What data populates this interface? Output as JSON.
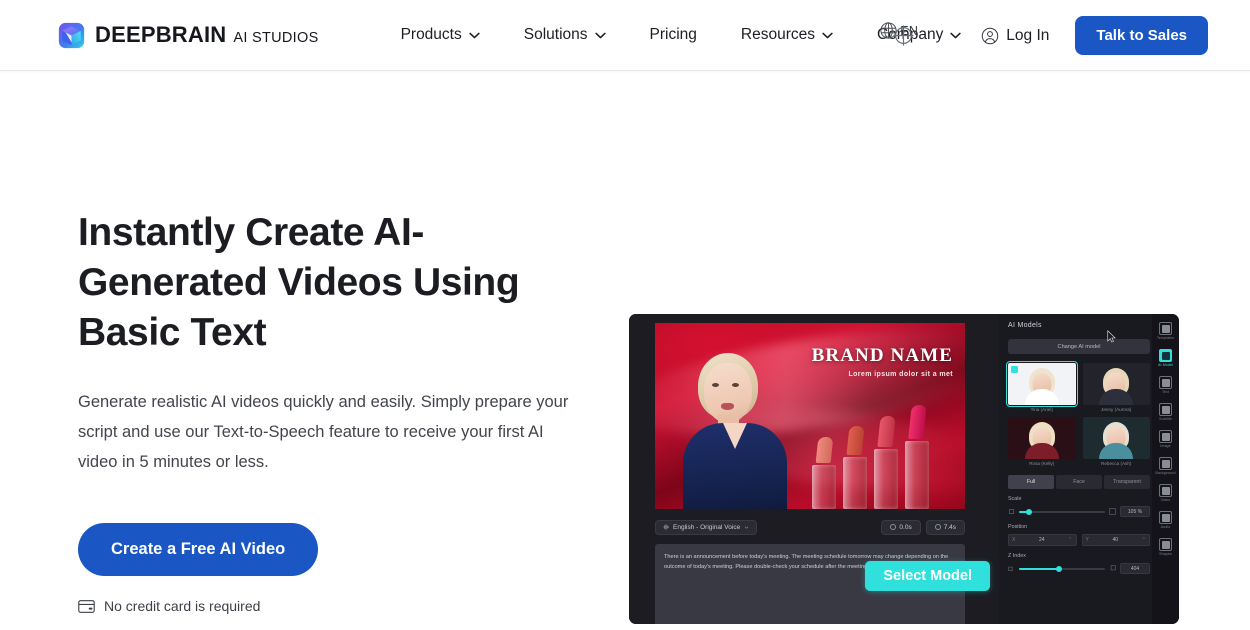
{
  "brand": {
    "logo_icon": "deepbrain-cube-logo",
    "name": "DEEPBRAIN",
    "sub": "AI STUDIOS"
  },
  "header": {
    "nav": [
      {
        "label": "Products",
        "has_chevron": true,
        "icon": "chevron-down-icon"
      },
      {
        "label": "Solutions",
        "has_chevron": true,
        "icon": "chevron-down-icon"
      },
      {
        "label": "Pricing",
        "has_chevron": false,
        "icon": ""
      },
      {
        "label": "Resources",
        "has_chevron": true,
        "icon": "chevron-down-icon"
      },
      {
        "label": "Company",
        "has_chevron": true,
        "icon": "chevron-down-icon"
      }
    ],
    "language": {
      "icon": "globe-icon",
      "code": "EN"
    },
    "login": {
      "label": "Log In",
      "icon": "user-circle-icon"
    },
    "cta": {
      "label": "Talk to Sales"
    }
  },
  "hero": {
    "title": "Instantly Create AI-Generated Videos Using Basic Text",
    "subtitle": "Generate realistic AI videos quickly and easily. Simply prepare your script and use our Text-to-Speech feature to receive your first AI video in 5 minutes or less.",
    "cta_label": "Create a Free AI Video",
    "note": "No credit card is required",
    "note_icon": "credit-card-icon"
  },
  "demo": {
    "stage": {
      "brand_title": "BRAND NAME",
      "brand_sub": "Lorem ipsum dolor sit a met"
    },
    "voice_chip": {
      "icon": "voice-wave-icon",
      "label": "English - Original Voice"
    },
    "timing": [
      {
        "icon": "clock-icon",
        "label": "0.0s"
      },
      {
        "icon": "clock-icon",
        "label": "7.4s"
      }
    ],
    "script": "There is an announcement before today's meeting. The meeting schedule tomorrow may change depending on the outcome of today's meeting. Please double-check your schedule after the meeting.",
    "select_model_label": "Select Model",
    "side": {
      "title": "AI Models",
      "change_model_label": "Change AI model",
      "models": [
        {
          "label": "Tina (Ariel)",
          "active": true,
          "hair": "#f0e3cd",
          "body": "#f2f3f6"
        },
        {
          "label": "Jenny (Aurora)",
          "active": false,
          "hair": "#e9d8b8",
          "body": "#2d2f3d"
        },
        {
          "label": "Rosa (Kelly)",
          "active": false,
          "hair": "#efe0c3",
          "body": "#7e1d2a"
        },
        {
          "label": "Rebecca (Ash)",
          "active": false,
          "hair": "#e6dfd2",
          "body": "#4a8f9e"
        }
      ],
      "segments": [
        {
          "label": "Full",
          "active": true
        },
        {
          "label": "Face",
          "active": false
        },
        {
          "label": "Transparent",
          "active": false
        }
      ],
      "controls": [
        {
          "name": "Scale",
          "type": "slider",
          "fill_pct": 12,
          "value": "105 %"
        },
        {
          "name": "Position",
          "type": "xy",
          "x_axis": "X",
          "x_value": "24",
          "y_axis": "Y",
          "y_value": "40"
        },
        {
          "name": "Z Index",
          "type": "slider",
          "fill_pct": 46,
          "value": "404"
        }
      ]
    },
    "rail": [
      {
        "label": "Templates",
        "icon": "templates-icon",
        "active": false
      },
      {
        "label": "AI Model",
        "icon": "ai-model-icon",
        "active": true
      },
      {
        "label": "Text",
        "icon": "text-icon",
        "active": false
      },
      {
        "label": "Subtitle",
        "icon": "subtitle-icon",
        "active": false
      },
      {
        "label": "Image",
        "icon": "image-icon",
        "active": false
      },
      {
        "label": "Background",
        "icon": "background-icon",
        "active": false
      },
      {
        "label": "Video",
        "icon": "video-icon",
        "active": false
      },
      {
        "label": "Audio",
        "icon": "audio-icon",
        "active": false
      },
      {
        "label": "Shapes",
        "icon": "shapes-icon",
        "active": false
      }
    ],
    "cursor_icon": "mouse-pointer-icon"
  },
  "page_cursor_icon": "crosshair-cursor-icon",
  "colors": {
    "brand_blue": "#1a56c4",
    "accent_teal": "#2fe0dc",
    "text_dark": "#1b1d22",
    "text_muted": "#42454d",
    "panel_dark": "#191920"
  }
}
